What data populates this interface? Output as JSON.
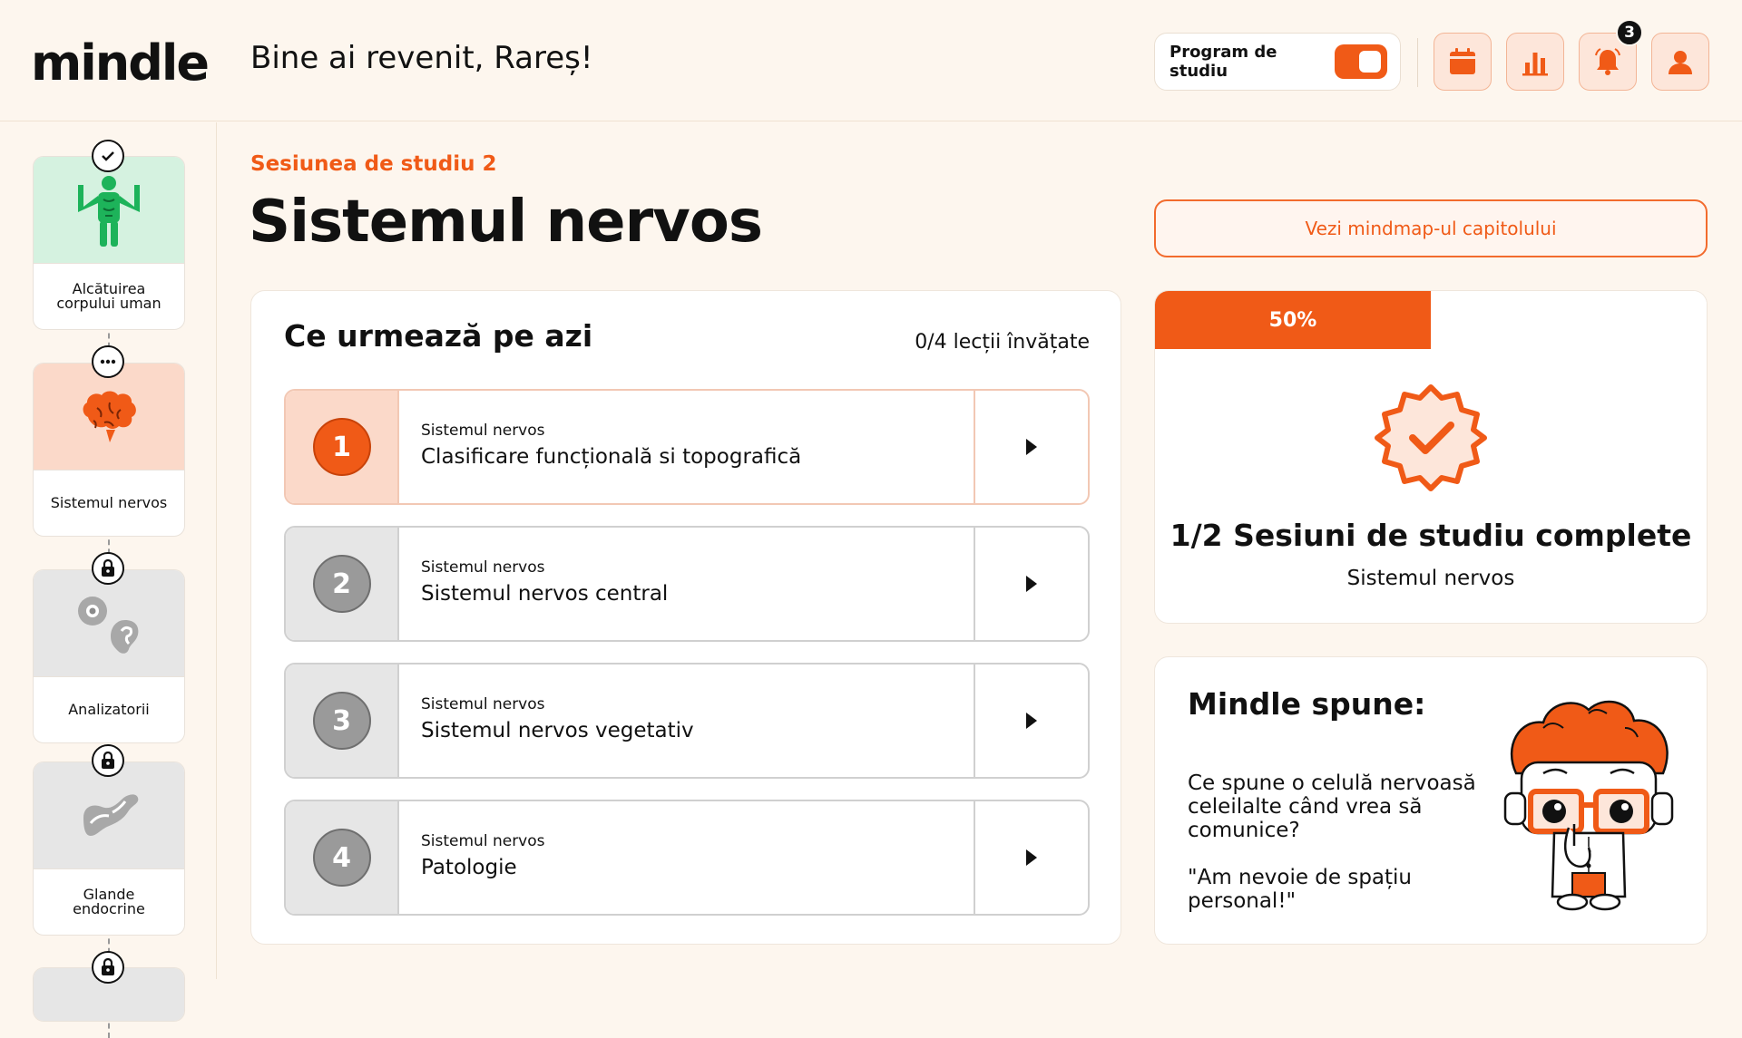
{
  "app": {
    "logo": "mindle",
    "greeting": "Bine ai revenit, Rareș!"
  },
  "header": {
    "study_program_label": "Program de studiu",
    "study_program_on": true,
    "notification_count": "3",
    "icons": [
      "calendar-icon",
      "stats-icon",
      "bell-icon",
      "profile-icon"
    ]
  },
  "sidebar": {
    "chapters": [
      {
        "title": "Alcătuirea corpului uman",
        "status": "completed",
        "icon": "human-body-icon"
      },
      {
        "title": "Sistemul nervos",
        "status": "in-progress",
        "icon": "brain-icon"
      },
      {
        "title": "Analizatorii",
        "status": "locked",
        "icon": "eye-ear-icon"
      },
      {
        "title": "Glande endocrine",
        "status": "locked",
        "icon": "pancreas-icon"
      },
      {
        "title": "",
        "status": "locked",
        "icon": ""
      }
    ]
  },
  "main": {
    "session_label": "Sesiunea de studiu 2",
    "title": "Sistemul nervos",
    "mindmap_button": "Vezi mindmap-ul capitolului"
  },
  "lessons": {
    "heading": "Ce urmează pe azi",
    "count": "0/4 lecții învățate",
    "items": [
      {
        "number": "1",
        "subtitle": "Sistemul nervos",
        "title": "Clasificare funcțională si topografică",
        "active": true
      },
      {
        "number": "2",
        "subtitle": "Sistemul nervos",
        "title": "Sistemul nervos central",
        "active": false
      },
      {
        "number": "3",
        "subtitle": "Sistemul nervos",
        "title": "Sistemul nervos vegetativ",
        "active": false
      },
      {
        "number": "4",
        "subtitle": "Sistemul nervos",
        "title": "Patologie",
        "active": false
      }
    ]
  },
  "progress": {
    "percent_label": "50%",
    "percent": 50,
    "title": "1/2 Sesiuni de studiu complete",
    "subtitle": "Sistemul nervos"
  },
  "mindle": {
    "title": "Mindle spune:",
    "joke": "Ce spune o celulă nervoasă celeilalte când vrea să comunice?\n\n\"Am nevoie de spațiu personal!\""
  },
  "colors": {
    "accent": "#f05a17",
    "background": "#fdf6ee",
    "completed_green": "#d5f2e0"
  }
}
